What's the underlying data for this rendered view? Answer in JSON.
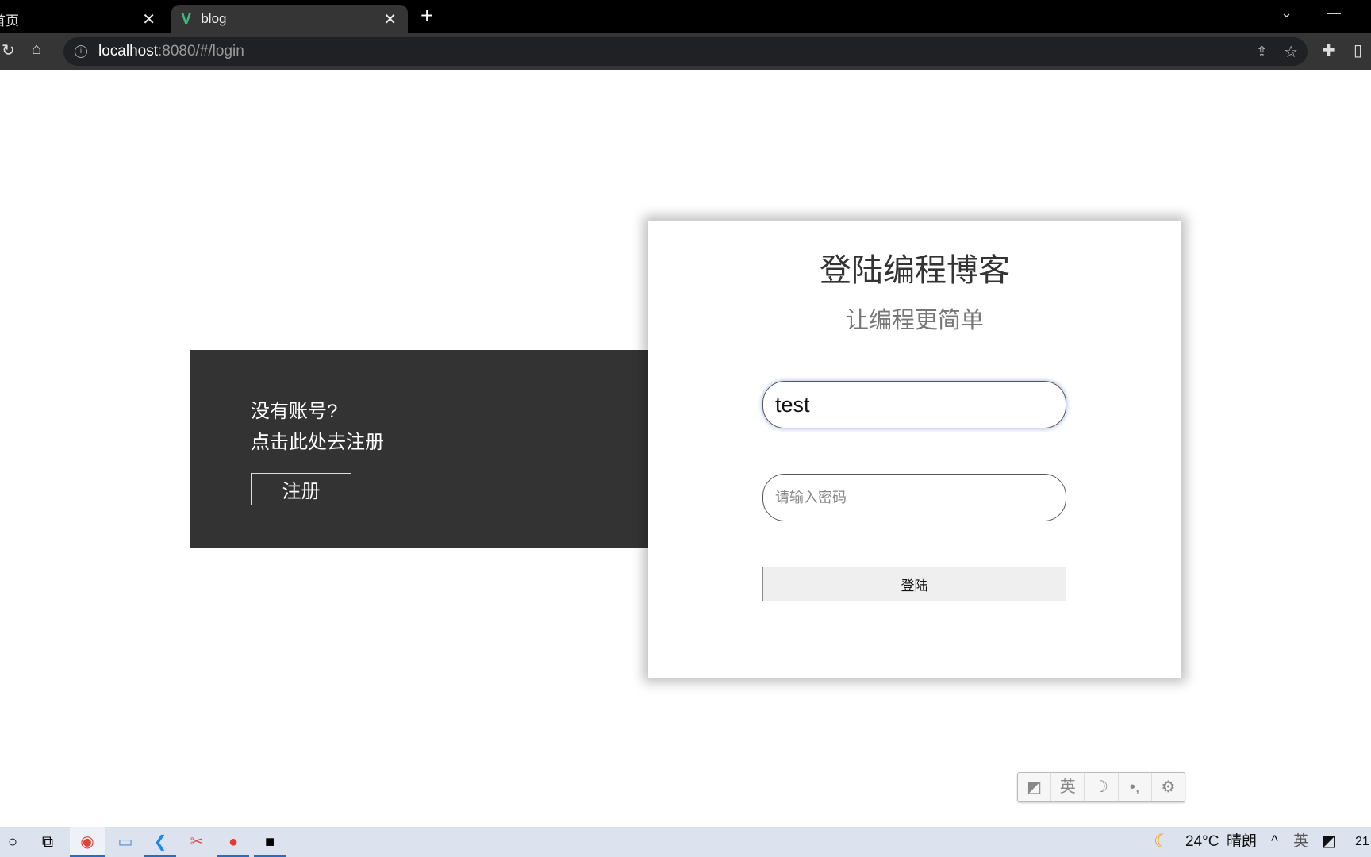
{
  "browser": {
    "tabs": [
      {
        "label": "首页",
        "active": false
      },
      {
        "label": "blog",
        "active": true
      }
    ],
    "url_host": "localhost",
    "url_rest": ":8080/#/login"
  },
  "panel": {
    "line1": "没有账号?",
    "line2": "点击此处去注册",
    "register_button": "注册"
  },
  "login": {
    "title": "登陆编程博客",
    "subtitle": "让编程更简单",
    "username_value": "test",
    "password_placeholder": "请输入密码",
    "login_button": "登陆"
  },
  "ime_toolbar": {
    "lang": "英"
  },
  "taskbar": {
    "weather_temp": "24°C",
    "weather_text": "晴朗",
    "ime": "英",
    "clock": "21"
  }
}
